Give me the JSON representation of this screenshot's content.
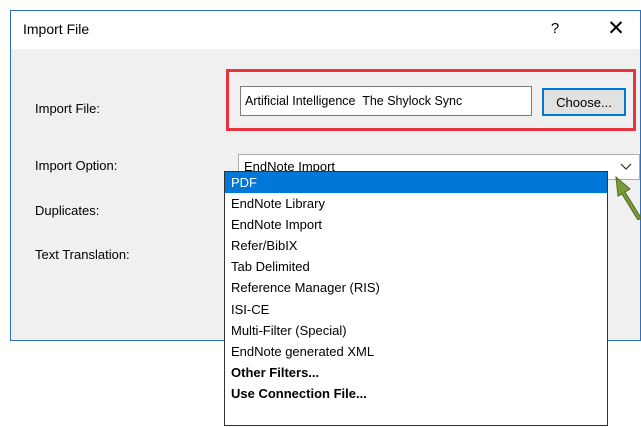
{
  "dialog": {
    "title": "Import File",
    "help_label": "?",
    "close_label": "✕"
  },
  "form": {
    "import_file_label": "Import File:",
    "import_file_value": "Artificial Intelligence  The Shylock Sync",
    "choose_label": "Choose...",
    "import_option_label": "Import Option:",
    "import_option_value": "EndNote Import",
    "duplicates_label": "Duplicates:",
    "text_translation_label": "Text Translation:"
  },
  "dropdown": {
    "options": [
      "PDF",
      "EndNote Library",
      "EndNote Import",
      "Refer/BibIX",
      "Tab Delimited",
      "Reference Manager (RIS)",
      "ISI-CE",
      "Multi-Filter (Special)",
      "EndNote generated XML",
      "Other Filters...",
      "Use Connection File..."
    ],
    "selected": "PDF"
  },
  "colors": {
    "accent": "#0078d7",
    "highlight": "#e8323c",
    "annotation_arrow": "#7a9a3a"
  },
  "icons": {
    "dropdown_arrow": "chevron-down-icon",
    "annotation": "arrow-icon"
  }
}
